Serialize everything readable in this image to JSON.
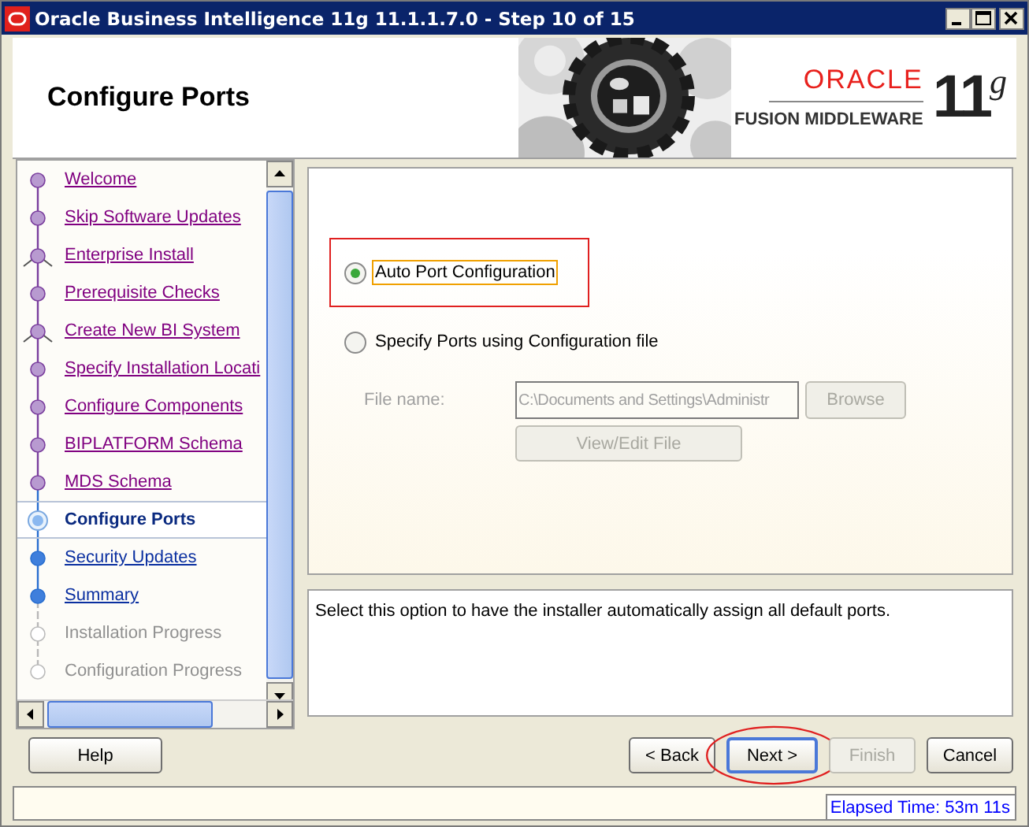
{
  "window": {
    "title": "Oracle Business Intelligence 11g 11.1.1.7.0 - Step 10 of 15"
  },
  "header": {
    "title": "Configure Ports",
    "logo": {
      "brand": "ORACLE",
      "product": "FUSION MIDDLEWARE",
      "version": "11",
      "version_suffix": "g"
    }
  },
  "steps": [
    {
      "label": "Welcome",
      "completed": true,
      "selected": false,
      "disabled": false,
      "branch": false
    },
    {
      "label": "Skip Software Updates",
      "completed": true,
      "selected": false,
      "disabled": false,
      "branch": false
    },
    {
      "label": "Enterprise Install",
      "completed": true,
      "selected": false,
      "disabled": false,
      "branch": true
    },
    {
      "label": "Prerequisite Checks",
      "completed": true,
      "selected": false,
      "disabled": false,
      "branch": false
    },
    {
      "label": "Create New BI System",
      "completed": true,
      "selected": false,
      "disabled": false,
      "branch": true
    },
    {
      "label": "Specify Installation Locati",
      "completed": true,
      "selected": false,
      "disabled": false,
      "branch": false
    },
    {
      "label": "Configure Components",
      "completed": true,
      "selected": false,
      "disabled": false,
      "branch": false
    },
    {
      "label": "BIPLATFORM Schema",
      "completed": true,
      "selected": false,
      "disabled": false,
      "branch": false
    },
    {
      "label": "MDS Schema",
      "completed": true,
      "selected": false,
      "disabled": false,
      "branch": false
    },
    {
      "label": "Configure Ports",
      "completed": false,
      "selected": true,
      "disabled": false,
      "branch": false
    },
    {
      "label": "Security Updates",
      "completed": false,
      "selected": false,
      "disabled": false,
      "branch": false
    },
    {
      "label": "Summary",
      "completed": false,
      "selected": false,
      "disabled": false,
      "branch": false
    },
    {
      "label": "Installation Progress",
      "completed": false,
      "selected": false,
      "disabled": true,
      "branch": false
    },
    {
      "label": "Configuration Progress",
      "completed": false,
      "selected": false,
      "disabled": true,
      "branch": false
    }
  ],
  "options": [
    {
      "label": "Auto Port Configuration",
      "selected": true,
      "highlighted": true
    },
    {
      "label": "Specify Ports using Configuration file",
      "selected": false,
      "highlighted": false
    }
  ],
  "file_field": {
    "label": "File name:",
    "value": "C:\\Documents and Settings\\Administr",
    "disabled": true
  },
  "browse_button": {
    "label": "Browse",
    "disabled": true
  },
  "view_edit_button": {
    "label": "View/Edit File",
    "disabled": true
  },
  "description": "Select this option to have the installer automatically assign all default ports.",
  "left_buttons": [
    {
      "label": "Help",
      "disabled": false,
      "circled": false
    }
  ],
  "right_buttons": [
    {
      "label": "< Back",
      "disabled": false,
      "circled": false
    },
    {
      "label": "Next >",
      "disabled": false,
      "circled": true
    },
    {
      "label": "Finish",
      "disabled": true,
      "circled": false
    },
    {
      "label": "Cancel",
      "disabled": false,
      "circled": false
    }
  ],
  "status_bar": {
    "elapsed": "Elapsed Time: 53m 11s"
  }
}
